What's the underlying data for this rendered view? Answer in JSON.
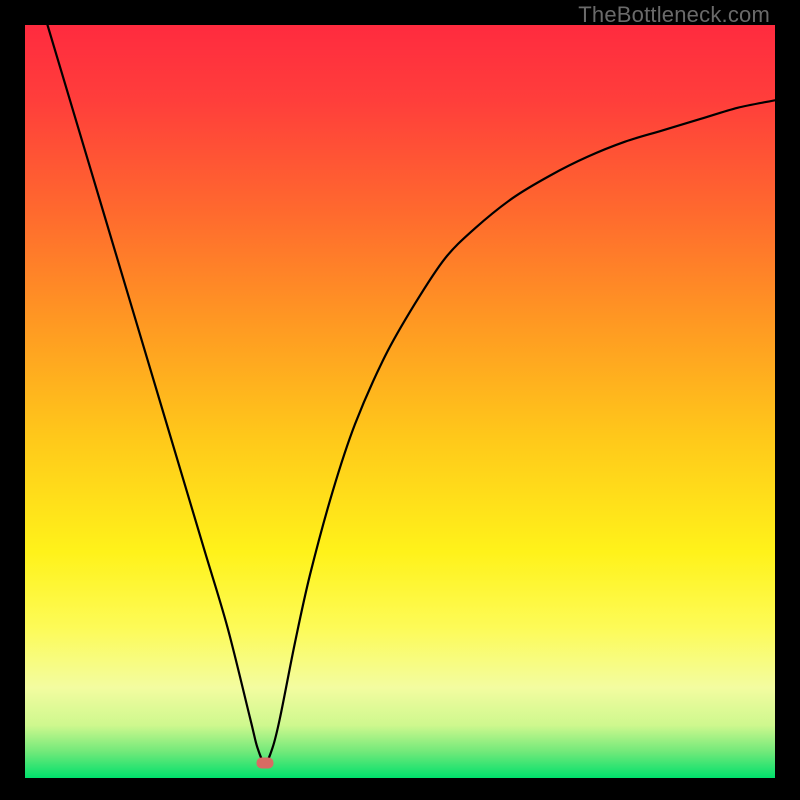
{
  "watermark": {
    "text": "TheBottleneck.com"
  },
  "colors": {
    "border": "#000000",
    "curve": "#000000",
    "marker": "#d96b63",
    "gradient_stops": [
      {
        "offset": 0.0,
        "color": "#ff2b3f"
      },
      {
        "offset": 0.1,
        "color": "#ff3e3b"
      },
      {
        "offset": 0.25,
        "color": "#ff6a2e"
      },
      {
        "offset": 0.4,
        "color": "#ff9a22"
      },
      {
        "offset": 0.55,
        "color": "#ffc91a"
      },
      {
        "offset": 0.7,
        "color": "#fff21a"
      },
      {
        "offset": 0.8,
        "color": "#fdfb57"
      },
      {
        "offset": 0.88,
        "color": "#f3fca0"
      },
      {
        "offset": 0.93,
        "color": "#cef88e"
      },
      {
        "offset": 0.965,
        "color": "#72e97a"
      },
      {
        "offset": 1.0,
        "color": "#00e06c"
      }
    ]
  },
  "chart_data": {
    "type": "line",
    "title": "",
    "xlabel": "",
    "ylabel": "",
    "xlim": [
      0,
      100
    ],
    "ylim": [
      0,
      100
    ],
    "grid": false,
    "legend": false,
    "annotations": [
      {
        "type": "marker",
        "x": 32,
        "y": 2,
        "label": ""
      }
    ],
    "series": [
      {
        "name": "curve",
        "x": [
          3,
          6,
          9,
          12,
          15,
          18,
          21,
          24,
          27,
          30,
          31,
          32,
          33,
          34,
          36,
          38,
          41,
          44,
          48,
          52,
          56,
          60,
          65,
          70,
          75,
          80,
          85,
          90,
          95,
          100
        ],
        "y": [
          100,
          90,
          80,
          70,
          60,
          50,
          40,
          30,
          20,
          8,
          4,
          2,
          4,
          8,
          18,
          27,
          38,
          47,
          56,
          63,
          69,
          73,
          77,
          80,
          82.5,
          84.5,
          86,
          87.5,
          89,
          90
        ]
      }
    ]
  }
}
